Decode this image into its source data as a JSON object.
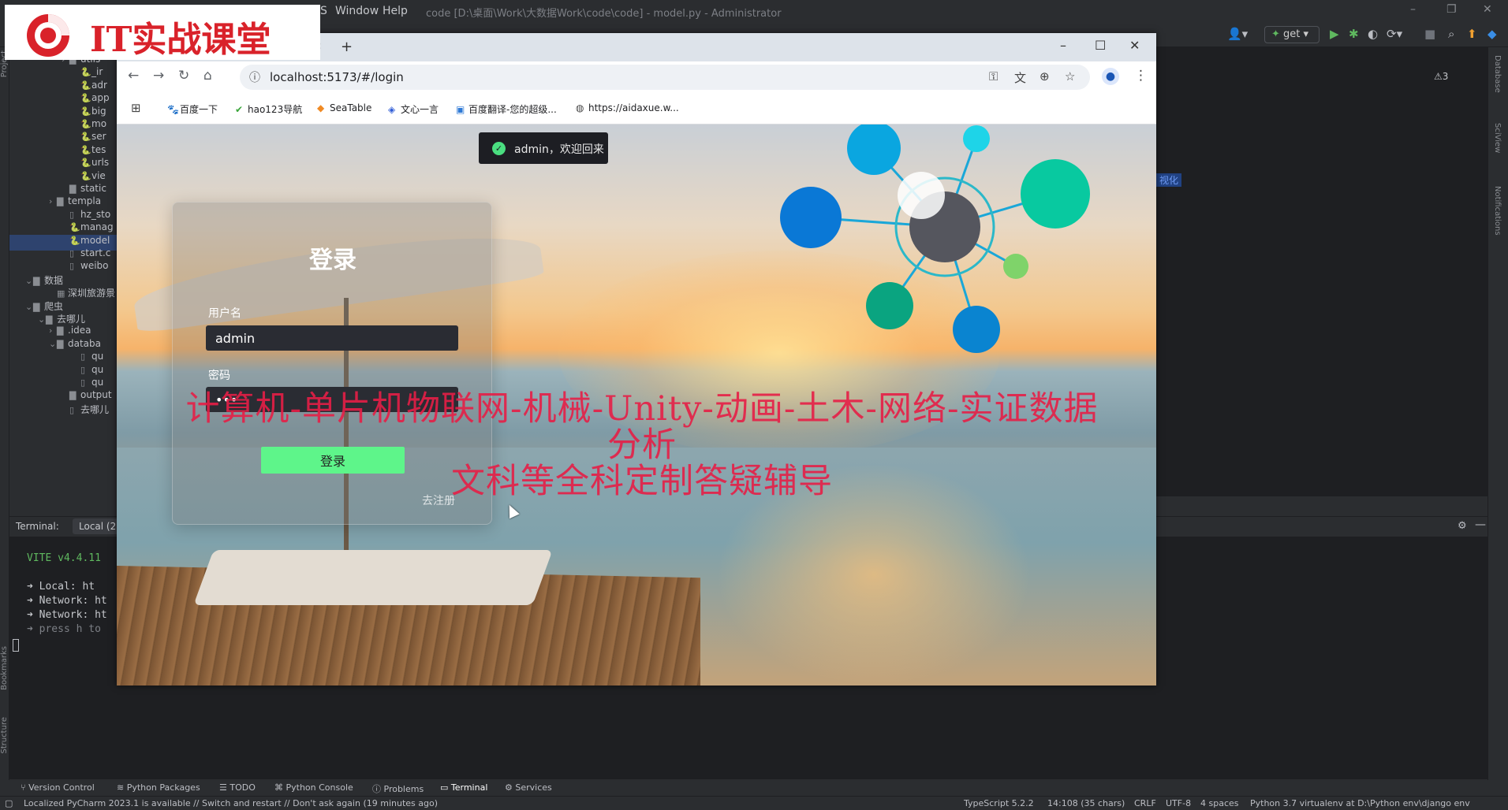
{
  "logo": {
    "text": "IT实战课堂"
  },
  "ide": {
    "menu": [
      "S",
      "Window",
      "Help"
    ],
    "title": "code [D:\\桌面\\Work\\大数据Work\\code\\code] - model.py - Administrator",
    "run_config": "get",
    "warnings": "⚠3",
    "editor_snippet": "视化",
    "left_stripe": [
      "Project",
      "Bookmarks",
      "Structure"
    ],
    "right_stripe": [
      "Database",
      "SciView",
      "Notifications"
    ],
    "tree": [
      {
        "label": "utils",
        "icon": "folder-icon",
        "indent": 66,
        "arrow": "›"
      },
      {
        "label": "_ir",
        "icon": "python-file-icon",
        "indent": 80,
        "arrow": ""
      },
      {
        "label": "adr",
        "icon": "python-file-icon",
        "indent": 80,
        "arrow": ""
      },
      {
        "label": "app",
        "icon": "python-file-icon",
        "indent": 80,
        "arrow": ""
      },
      {
        "label": "big",
        "icon": "python-file-icon",
        "indent": 80,
        "arrow": ""
      },
      {
        "label": "mo",
        "icon": "python-file-icon",
        "indent": 80,
        "arrow": ""
      },
      {
        "label": "ser",
        "icon": "python-file-icon",
        "indent": 80,
        "arrow": ""
      },
      {
        "label": "tes",
        "icon": "python-file-icon",
        "indent": 80,
        "arrow": ""
      },
      {
        "label": "urls",
        "icon": "python-file-icon",
        "indent": 80,
        "arrow": ""
      },
      {
        "label": "vie",
        "icon": "python-file-icon",
        "indent": 80,
        "arrow": ""
      },
      {
        "label": "static",
        "icon": "folder-icon",
        "indent": 66,
        "arrow": ""
      },
      {
        "label": "templa",
        "icon": "folder-icon",
        "indent": 50,
        "arrow": "›"
      },
      {
        "label": "hz_sto",
        "icon": "file-icon",
        "indent": 66,
        "arrow": ""
      },
      {
        "label": "manag",
        "icon": "python-file-icon",
        "indent": 66,
        "arrow": ""
      },
      {
        "label": "model",
        "icon": "python-file-icon",
        "indent": 66,
        "arrow": "",
        "selected": true
      },
      {
        "label": "start.c",
        "icon": "file-icon",
        "indent": 66,
        "arrow": ""
      },
      {
        "label": "weibo",
        "icon": "file-icon",
        "indent": 66,
        "arrow": ""
      },
      {
        "label": "数据",
        "icon": "folder-icon",
        "indent": 20,
        "arrow": "⌄"
      },
      {
        "label": "深圳旅游景",
        "icon": "csv-file-icon",
        "indent": 50,
        "arrow": ""
      },
      {
        "label": "爬虫",
        "icon": "folder-icon",
        "indent": 20,
        "arrow": "⌄"
      },
      {
        "label": "去哪儿",
        "icon": "folder-icon",
        "indent": 36,
        "arrow": "⌄"
      },
      {
        "label": ".idea",
        "icon": "folder-icon",
        "indent": 50,
        "arrow": "›"
      },
      {
        "label": "databa",
        "icon": "folder-icon",
        "indent": 50,
        "arrow": "⌄"
      },
      {
        "label": "qu",
        "icon": "file-icon",
        "indent": 80,
        "arrow": ""
      },
      {
        "label": "qu",
        "icon": "file-icon",
        "indent": 80,
        "arrow": ""
      },
      {
        "label": "qu",
        "icon": "file-icon",
        "indent": 80,
        "arrow": ""
      },
      {
        "label": "output",
        "icon": "folder-icon",
        "indent": 66,
        "arrow": ""
      },
      {
        "label": "去哪儿",
        "icon": "file-icon",
        "indent": 66,
        "arrow": ""
      }
    ],
    "terminal": {
      "label": "Terminal:",
      "tab": "Local (2)",
      "lines": [
        {
          "text": "VITE v4.4.11",
          "color": "#5fb85f"
        },
        {
          "text": "➜  Local:   ht",
          "color": "#c6c8cc"
        },
        {
          "text": "➜  Network: ht",
          "color": "#c6c8cc"
        },
        {
          "text": "➜  Network: ht",
          "color": "#c6c8cc"
        },
        {
          "text": "➜  press h to",
          "color": "#7c7f85"
        }
      ]
    },
    "tool_tabs": [
      "Version Control",
      "Python Packages",
      "TODO",
      "Python Console",
      "Problems",
      "Terminal",
      "Services"
    ],
    "status_left": "Localized PyCharm 2023.1 is available // Switch and restart // Don't ask again (19 minutes ago)",
    "status_right": [
      "TypeScript 5.2.2",
      "14:108 (35 chars)",
      "CRLF",
      "UTF-8",
      "4 spaces",
      "Python 3.7 virtualenv at D:\\Python env\\django env"
    ]
  },
  "browser": {
    "url": "localhost:5173/#/login",
    "bookmarks": [
      {
        "label": "百度一下",
        "icon": "paw-icon",
        "color": "#2f5cd6"
      },
      {
        "label": "hao123导航",
        "icon": "check-leaf-icon",
        "color": "#3aa53a"
      },
      {
        "label": "SeaTable",
        "icon": "flame-icon",
        "color": "#f08a24"
      },
      {
        "label": "文心一言",
        "icon": "wenxin-icon",
        "color": "#2f5cd6"
      },
      {
        "label": "百度翻译-您的超级...",
        "icon": "translate-icon",
        "color": "#2f7ad6"
      },
      {
        "label": "https://aidaxue.w...",
        "icon": "globe-icon",
        "color": "#444"
      }
    ]
  },
  "page": {
    "toast": "admin，欢迎回来",
    "login": {
      "title": "登录",
      "username_label": "用户名",
      "username_value": "admin",
      "password_label": "密码",
      "password_value": "•••",
      "button": "登录",
      "register_link": "去注册"
    },
    "watermark_lines": [
      "计算机-单片机物联网-机械-Unity-动画-土木-网络-实证数据分析",
      "文科等全科定制答疑辅导"
    ]
  }
}
